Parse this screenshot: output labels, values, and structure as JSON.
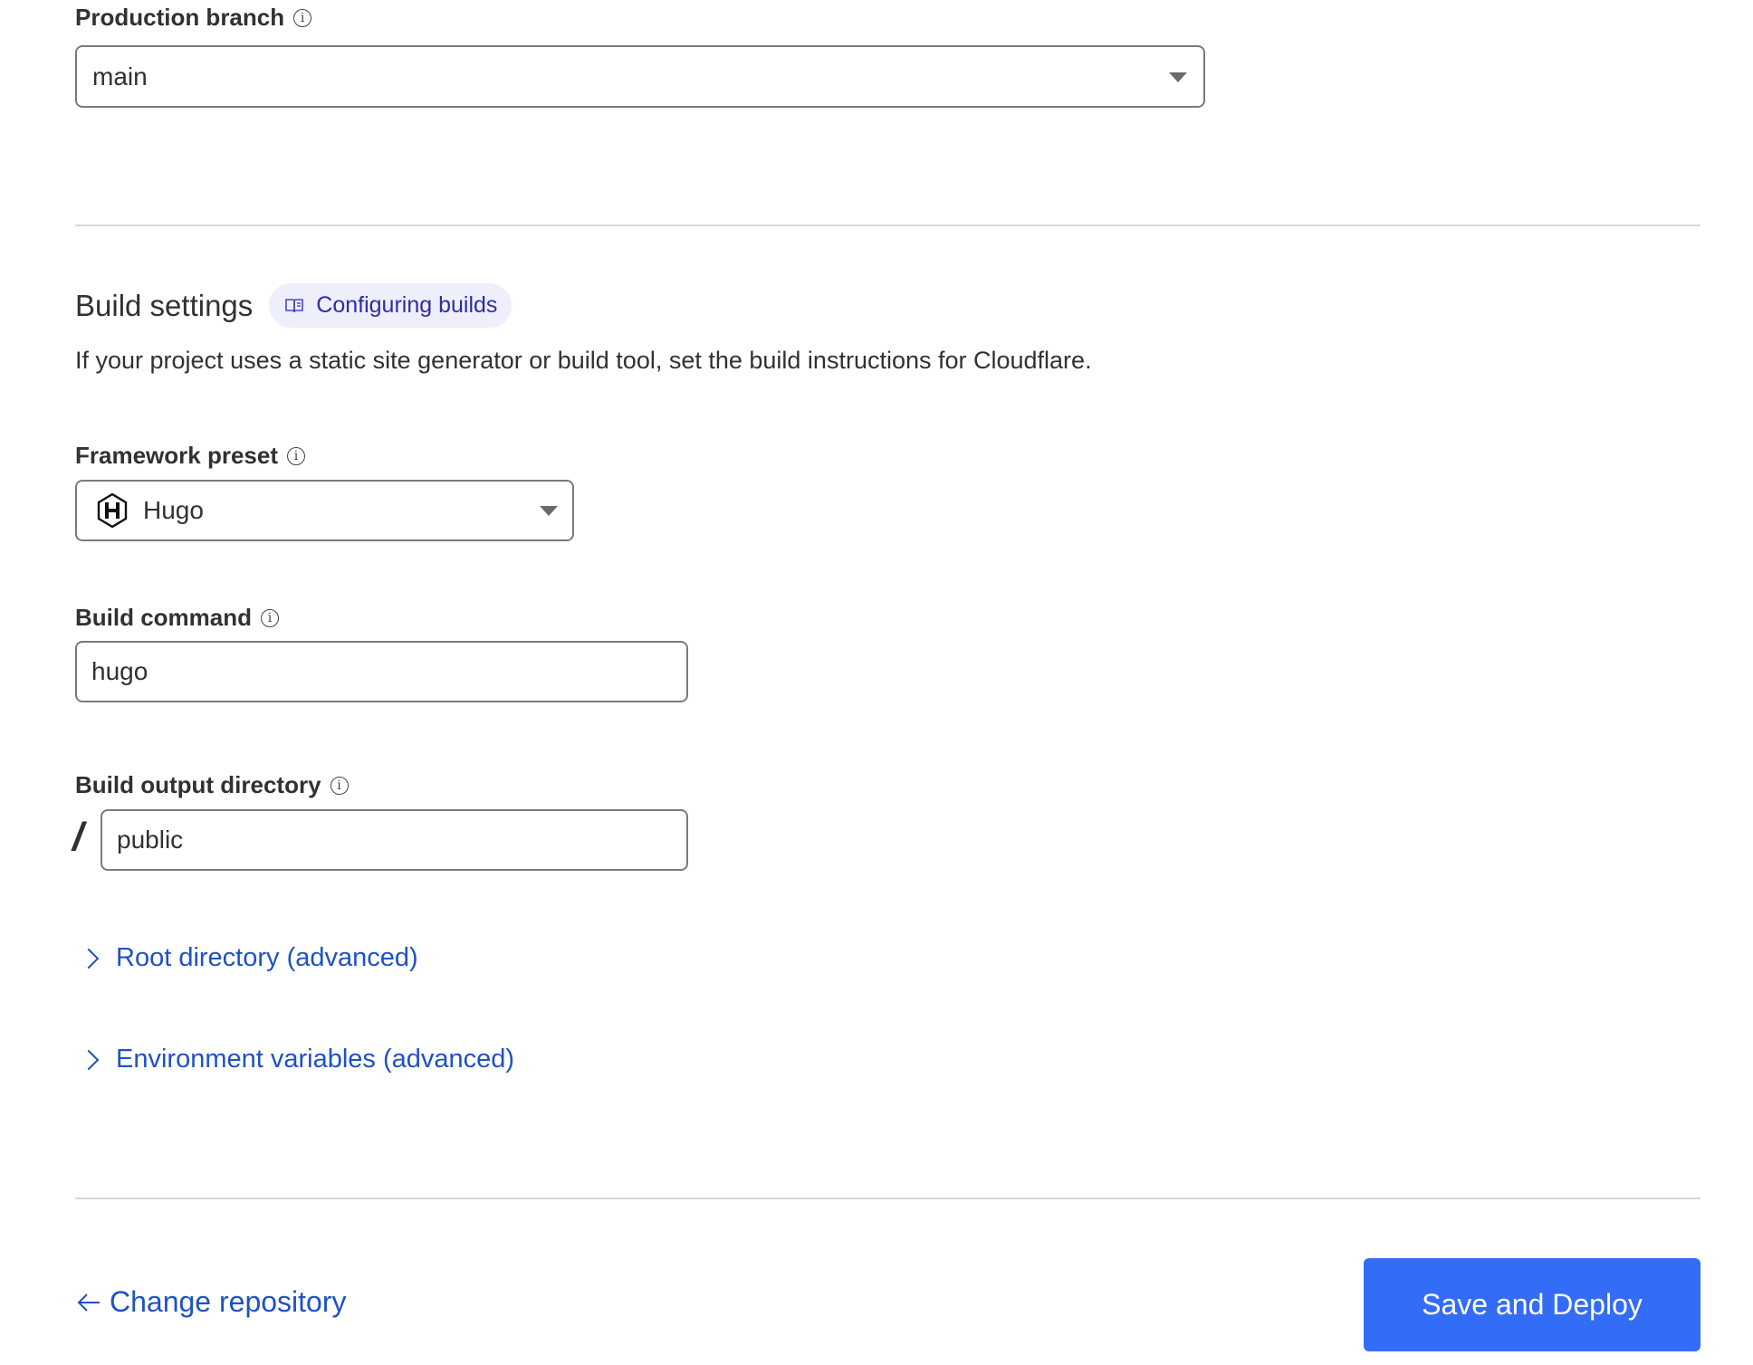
{
  "production_branch": {
    "label": "Production branch",
    "info_icon": "info-icon",
    "value": "main"
  },
  "build_settings": {
    "title": "Build settings",
    "docs_chip": {
      "icon": "book-icon",
      "label": "Configuring builds"
    },
    "description": "If your project uses a static site generator or build tool, set the build instructions for Cloudflare.",
    "framework_preset": {
      "label": "Framework preset",
      "value": "Hugo",
      "icon": "hugo-logo-icon"
    },
    "build_command": {
      "label": "Build command",
      "value": "hugo"
    },
    "build_output_directory": {
      "label": "Build output directory",
      "prefix": "/",
      "value": "public"
    },
    "advanced": [
      {
        "label": "Root directory (advanced)"
      },
      {
        "label": "Environment variables (advanced)"
      }
    ]
  },
  "footer": {
    "back_link": "Change repository",
    "back_icon": "arrow-left-icon",
    "primary_button": "Save and Deploy"
  },
  "colors": {
    "primary": "#336CF6",
    "link": "#1F52C2",
    "chip_bg": "#EFEEFB",
    "chip_text": "#2E2DA3",
    "text": "#313131",
    "border": "#7A7A7A",
    "divider": "#D8D8D8"
  }
}
